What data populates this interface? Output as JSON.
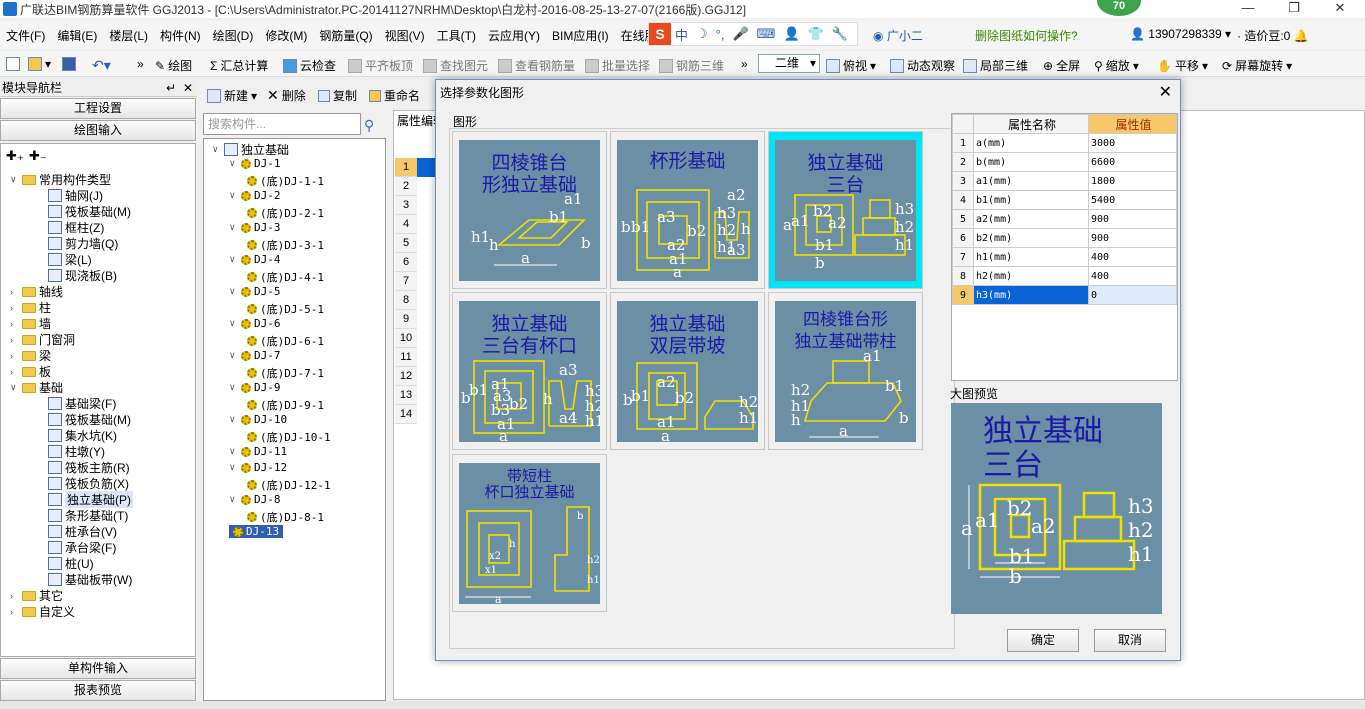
{
  "window": {
    "title": "广联达BIM钢筋算量软件 GGJ2013 - [C:\\Users\\Administrator.PC-20141127NRHM\\Desktop\\白龙村-2016-08-25-13-27-07(2166版).GGJ12]",
    "badge": "70"
  },
  "menu": [
    "文件(F)",
    "编辑(E)",
    "楼层(L)",
    "构件(N)",
    "绘图(D)",
    "修改(M)",
    "钢筋量(Q)",
    "视图(V)",
    "工具(T)",
    "云应用(Y)",
    "BIM应用(I)",
    "在线服务"
  ],
  "ime": {
    "logo": "S",
    "items": [
      "中",
      "☽",
      "°,",
      "🎤",
      "⌨",
      "👤",
      "👕",
      "🔧"
    ]
  },
  "menu_right": {
    "user": "广小二",
    "help": "删除图纸如何操作?",
    "phone": "13907298339",
    "beans": "造价豆:0"
  },
  "toolbar": {
    "draw": "绘图",
    "sum": "汇总计算",
    "cloud_check": "云检查",
    "flat": "平齐板顶",
    "find": "查找图元",
    "view_rebar": "查看钢筋量",
    "batch": "批量选择",
    "rebar3d": "钢筋三维",
    "view_mode": "二维",
    "top_view": "俯视",
    "dynamic": "动态观察",
    "local3d": "局部三维",
    "fullscreen": "全屏",
    "zoom": "缩放",
    "pan": "平移",
    "rotate": "屏幕旋转"
  },
  "nav": {
    "title": "模块导航栏",
    "project_settings": "工程设置",
    "draw_input": "绘图输入",
    "single_input": "单构件输入",
    "report_preview": "报表预览",
    "tree": [
      {
        "label": "常用构件类型",
        "level": 0,
        "type": "folder",
        "open": true
      },
      {
        "label": "轴网(J)",
        "level": 1,
        "type": "comp"
      },
      {
        "label": "筏板基础(M)",
        "level": 1,
        "type": "comp"
      },
      {
        "label": "框柱(Z)",
        "level": 1,
        "type": "comp"
      },
      {
        "label": "剪力墙(Q)",
        "level": 1,
        "type": "comp"
      },
      {
        "label": "梁(L)",
        "level": 1,
        "type": "comp"
      },
      {
        "label": "现浇板(B)",
        "level": 1,
        "type": "comp"
      },
      {
        "label": "轴线",
        "level": 0,
        "type": "folder"
      },
      {
        "label": "柱",
        "level": 0,
        "type": "folder"
      },
      {
        "label": "墙",
        "level": 0,
        "type": "folder"
      },
      {
        "label": "门窗洞",
        "level": 0,
        "type": "folder"
      },
      {
        "label": "梁",
        "level": 0,
        "type": "folder"
      },
      {
        "label": "板",
        "level": 0,
        "type": "folder"
      },
      {
        "label": "基础",
        "level": 0,
        "type": "folder",
        "open": true
      },
      {
        "label": "基础梁(F)",
        "level": 1,
        "type": "comp"
      },
      {
        "label": "筏板基础(M)",
        "level": 1,
        "type": "comp"
      },
      {
        "label": "集水坑(K)",
        "level": 1,
        "type": "comp"
      },
      {
        "label": "柱墩(Y)",
        "level": 1,
        "type": "comp"
      },
      {
        "label": "筏板主筋(R)",
        "level": 1,
        "type": "comp"
      },
      {
        "label": "筏板负筋(X)",
        "level": 1,
        "type": "comp"
      },
      {
        "label": "独立基础(P)",
        "level": 1,
        "type": "comp",
        "selected": true
      },
      {
        "label": "条形基础(T)",
        "level": 1,
        "type": "comp"
      },
      {
        "label": "桩承台(V)",
        "level": 1,
        "type": "comp"
      },
      {
        "label": "承台梁(F)",
        "level": 1,
        "type": "comp"
      },
      {
        "label": "桩(U)",
        "level": 1,
        "type": "comp"
      },
      {
        "label": "基础板带(W)",
        "level": 1,
        "type": "comp"
      },
      {
        "label": "其它",
        "level": 0,
        "type": "folder"
      },
      {
        "label": "自定义",
        "level": 0,
        "type": "folder"
      }
    ]
  },
  "components": {
    "toolbar": {
      "new": "新建",
      "delete": "删除",
      "copy": "复制",
      "rename": "重命名"
    },
    "search_placeholder": "搜索构件...",
    "root": "独立基础",
    "items": [
      {
        "label": "DJ-1",
        "level": 1
      },
      {
        "label": "(底)DJ-1-1",
        "level": 2
      },
      {
        "label": "DJ-2",
        "level": 1
      },
      {
        "label": "(底)DJ-2-1",
        "level": 2
      },
      {
        "label": "DJ-3",
        "level": 1
      },
      {
        "label": "(底)DJ-3-1",
        "level": 2
      },
      {
        "label": "DJ-4",
        "level": 1
      },
      {
        "label": "(底)DJ-4-1",
        "level": 2
      },
      {
        "label": "DJ-5",
        "level": 1
      },
      {
        "label": "(底)DJ-5-1",
        "level": 2
      },
      {
        "label": "DJ-6",
        "level": 1
      },
      {
        "label": "(底)DJ-6-1",
        "level": 2
      },
      {
        "label": "DJ-7",
        "level": 1
      },
      {
        "label": "(底)DJ-7-1",
        "level": 2
      },
      {
        "label": "DJ-9",
        "level": 1
      },
      {
        "label": "(底)DJ-9-1",
        "level": 2
      },
      {
        "label": "DJ-10",
        "level": 1
      },
      {
        "label": "(底)DJ-10-1",
        "level": 2
      },
      {
        "label": "DJ-11",
        "level": 1
      },
      {
        "label": "DJ-12",
        "level": 1
      },
      {
        "label": "(底)DJ-12-1",
        "level": 2
      },
      {
        "label": "DJ-8",
        "level": 1
      },
      {
        "label": "(底)DJ-8-1",
        "level": 2
      },
      {
        "label": "DJ-13",
        "level": 1,
        "selected": true
      }
    ]
  },
  "property_editor": {
    "title": "属性编辑",
    "rows": [
      "1",
      "2",
      "3",
      "4",
      "5",
      "6",
      "7",
      "8",
      "9",
      "10",
      "11",
      "12",
      "13",
      "14"
    ]
  },
  "dialog": {
    "title": "选择参数化图形",
    "shapes_label": "图形",
    "shapes": [
      {
        "label": "四棱锥台\n形独立基础",
        "selected": false
      },
      {
        "label": "杯形基础",
        "selected": false
      },
      {
        "label": "独立基础\n三台",
        "selected": true
      },
      {
        "label": "独立基础\n三台有杯口",
        "selected": false
      },
      {
        "label": "独立基础\n双层带坡",
        "selected": false
      },
      {
        "label": "四棱锥台形\n独立基础带柱",
        "selected": false
      },
      {
        "label": "带短柱\n杯口独立基础",
        "selected": false
      }
    ],
    "prop_headers": {
      "name": "属性名称",
      "value": "属性值"
    },
    "props": [
      {
        "n": "1",
        "k": "a(mm)",
        "v": "3000"
      },
      {
        "n": "2",
        "k": "b(mm)",
        "v": "6600"
      },
      {
        "n": "3",
        "k": "a1(mm)",
        "v": "1800"
      },
      {
        "n": "4",
        "k": "b1(mm)",
        "v": "5400"
      },
      {
        "n": "5",
        "k": "a2(mm)",
        "v": "900"
      },
      {
        "n": "6",
        "k": "b2(mm)",
        "v": "900"
      },
      {
        "n": "7",
        "k": "h1(mm)",
        "v": "400"
      },
      {
        "n": "8",
        "k": "h2(mm)",
        "v": "400"
      },
      {
        "n": "9",
        "k": "h3(mm)",
        "v": "0",
        "selected": true
      }
    ],
    "preview_label": "大图预览",
    "preview_title": "独立基础\n三台",
    "ok": "确定",
    "cancel": "取消"
  }
}
